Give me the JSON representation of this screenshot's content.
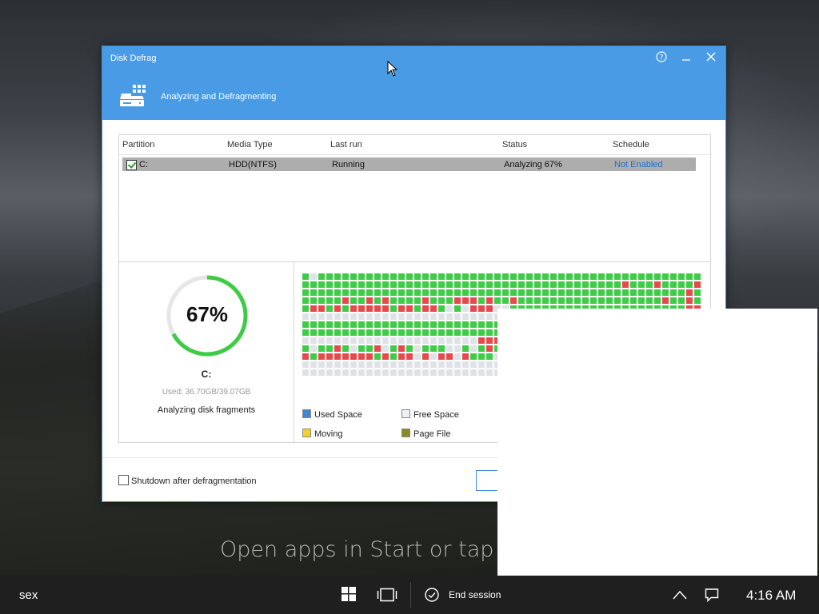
{
  "window": {
    "title": "Disk Defrag",
    "banner_text": "Analyzing and Defragmenting",
    "buttons": [
      "help-icon",
      "minimize-icon",
      "close-icon"
    ]
  },
  "table": {
    "headers": [
      "Partition",
      "Media Type",
      "Last run",
      "Status",
      "Schedule"
    ],
    "rows": [
      {
        "partition": "C:",
        "media_type": "HDD(NTFS)",
        "last_run": "Running",
        "status": "Analyzing 67%",
        "schedule": "Not Enabled",
        "checked": true
      }
    ]
  },
  "progress": {
    "percent_text": "67%",
    "percent": 0.67,
    "drive": "C:",
    "used": "Used: 36.70GB/39.07GB",
    "status_text": "Analyzing disk fragments"
  },
  "legend": {
    "used": "Used Space",
    "free": "Free Space",
    "moving": "Moving",
    "page_file": "Page File"
  },
  "colors": {
    "accent": "#4a9be6",
    "used": "#3ecb46",
    "fragmented": "#e8474c",
    "free": "#dfe2e6",
    "legend_used": "#3f86d4",
    "legend_moving": "#f2d22a",
    "legend_page": "#8a8a22"
  },
  "footer": {
    "shutdown_label": "Shutdown after defragmentation"
  },
  "desktop": {
    "hint": "Open apps in Start or tap En"
  },
  "taskbar": {
    "user": "sex",
    "end_session": "End session",
    "clock": "4:16 AM"
  },
  "block_map": [
    "gfgggggggggggggggggggggggggggggggggggggggggggggggg",
    "ggggggggggggggggggggggggggggggggggggggggrgggrggggr",
    "ggggggggggggggggggggggggggggggggggggggggggggggggrg",
    "gggggrggrgrggggrgggrrrgrggrggggggggggggggggggrggrg",
    "grrgrgrrrrrgrrgrrgfgfrrrffggggggggggggggggggggggrr",
    "ffffffffffffffffffffffffffffffffffffffffffffffffff",
    "gggggggggggggggggggggggggggggggggggggggggggggggggg",
    "gggggggggggggggggggggggggggggggggggggggggggggggggg",
    "ffffffffffffffffffffffrrrrfggggggggggggggggggggggg",
    "gfggrgfggrfgrgfgggffgfgrgggggggggggggggggggggggggg",
    "rgrrrrrrrgrgrrfrfrrfrgggfffffffffffffffffffffffffff",
    "ffffffffffffffffffffffffffffffffffffffffffffffffff",
    "ffffffffffffffffffffffffffffffffffffffffffffffffff"
  ]
}
